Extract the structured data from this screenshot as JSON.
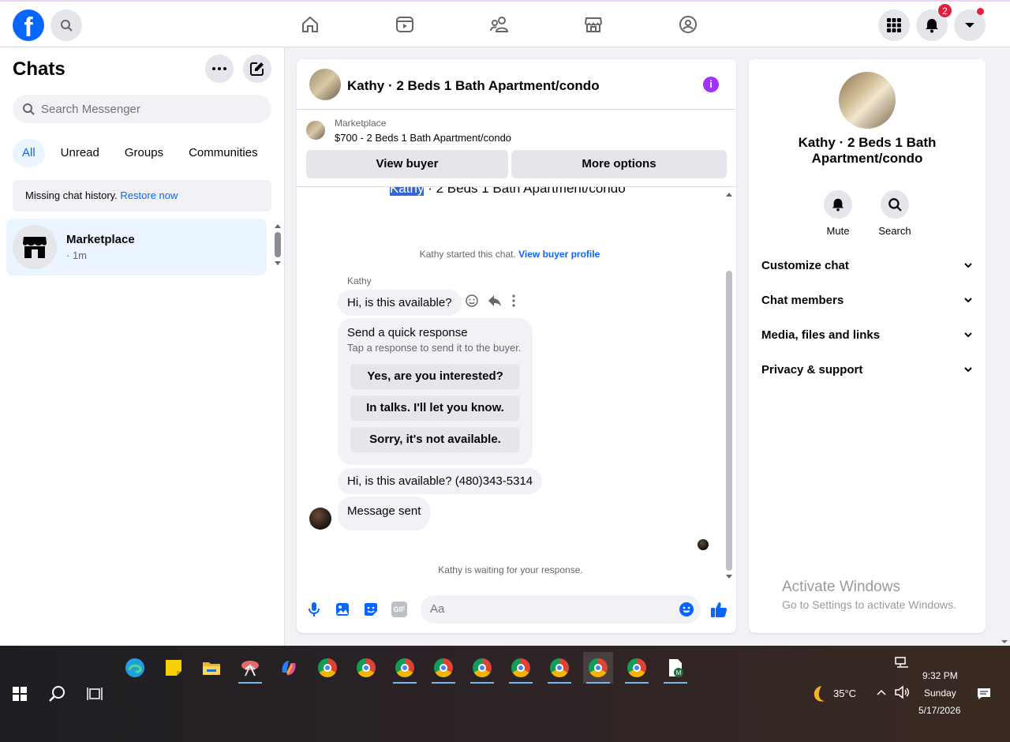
{
  "topbar": {
    "logo": "f",
    "notifications_badge": "2",
    "nav_icons": [
      "home-icon",
      "video-icon",
      "friends-icon",
      "marketplace-icon",
      "groups-icon"
    ]
  },
  "left": {
    "title": "Chats",
    "search_placeholder": "Search Messenger",
    "filters": [
      "All",
      "Unread",
      "Groups",
      "Communities"
    ],
    "missing_text": "Missing chat history.",
    "restore_link": "Restore now",
    "chat": {
      "name": "Marketplace",
      "time": "· 1m"
    }
  },
  "conversation": {
    "title": "Kathy · 2 Beds 1 Bath Apartment/condo",
    "marketplace_label": "Marketplace",
    "listing": "$700 - 2 Beds 1 Bath Apartment/condo",
    "view_buyer": "View buyer",
    "more_options": "More options",
    "top_name_highlight": "Kathy",
    "top_name_rest": " · 2 Beds 1 Bath Apartment/condo",
    "started_text": "Kathy started this chat.",
    "view_profile": "View buyer profile",
    "sender": "Kathy",
    "msg1": "Hi, is this available?",
    "quick_title": "Send a quick response",
    "quick_sub": "Tap a response to send it to the buyer.",
    "quick_options": [
      "Yes, are you interested?",
      "In talks. I'll let you know.",
      "Sorry, it's not available."
    ],
    "msg2": "Hi, is this available? (480)343-5314",
    "msg3": "Message sent",
    "waiting": "Kathy is waiting for your response.",
    "composer_placeholder": "Aa",
    "gif_label": "GIF"
  },
  "info": {
    "name": "Kathy · 2 Beds 1 Bath Apartment/condo",
    "mute": "Mute",
    "search": "Search",
    "sections": [
      "Customize chat",
      "Chat members",
      "Media, files and links",
      "Privacy & support"
    ]
  },
  "watermark": {
    "line1": "Activate Windows",
    "line2": "Go to Settings to activate Windows."
  },
  "taskbar": {
    "temperature": "35°C",
    "time": "9:32 PM",
    "day": "Sunday",
    "date": "5/17/2026"
  },
  "colors": {
    "brand": "#0866ff",
    "accent_purple": "#a033ff",
    "badge_red": "#e41e3f"
  }
}
